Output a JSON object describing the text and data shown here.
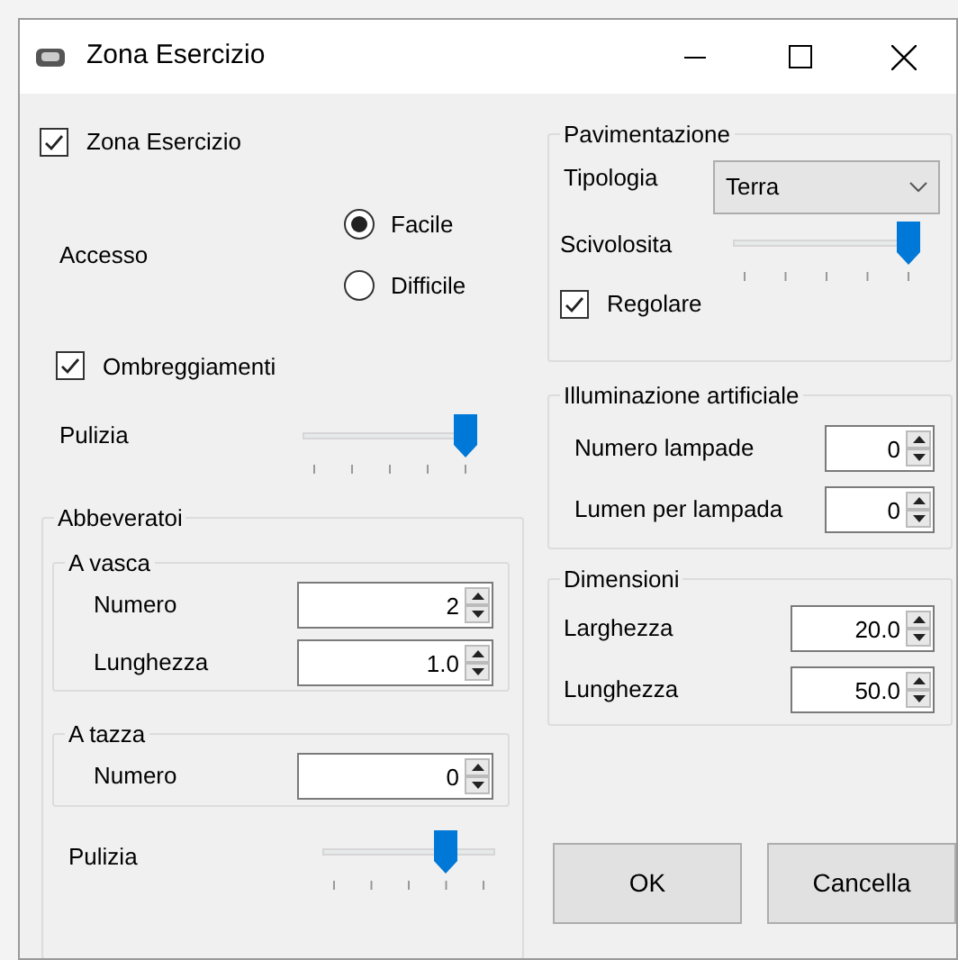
{
  "window": {
    "title": "Zona Esercizio"
  },
  "zona_esercizio": {
    "label": "Zona Esercizio",
    "checked": true
  },
  "accesso": {
    "label": "Accesso",
    "options": [
      {
        "label": "Facile",
        "selected": true
      },
      {
        "label": "Difficile",
        "selected": false
      }
    ]
  },
  "ombreggiamenti": {
    "label": "Ombreggiamenti",
    "checked": true
  },
  "pulizia": {
    "label": "Pulizia",
    "level": 1
  },
  "abbeveratoi": {
    "title": "Abbeveratoi",
    "groups": [
      {
        "title": "A vasca",
        "fields": [
          {
            "label": "Numero",
            "value": "2"
          },
          {
            "label": "Lunghezza",
            "value": "1.0"
          }
        ]
      },
      {
        "title": "A tazza",
        "fields": [
          {
            "label": "Numero",
            "value": "0"
          }
        ]
      }
    ],
    "pulizia": {
      "label": "Pulizia",
      "level": 0.75
    }
  },
  "pavimentazione": {
    "title": "Pavimentazione",
    "tipologia": {
      "label": "Tipologia",
      "value": "Terra"
    },
    "scivolosita": {
      "label": "Scivolosita",
      "level": 1
    },
    "regolare": {
      "label": "Regolare",
      "checked": true
    }
  },
  "illuminazione": {
    "title": "Illuminazione artificiale",
    "fields": [
      {
        "label": "Numero lampade",
        "value": "0"
      },
      {
        "label": "Lumen per lampada",
        "value": "0"
      }
    ]
  },
  "dimensioni": {
    "title": "Dimensioni",
    "fields": [
      {
        "label": "Larghezza",
        "value": "20.0"
      },
      {
        "label": "Lunghezza",
        "value": "50.0"
      }
    ]
  },
  "buttons": [
    {
      "label": "OK"
    },
    {
      "label": "Cancella"
    }
  ]
}
